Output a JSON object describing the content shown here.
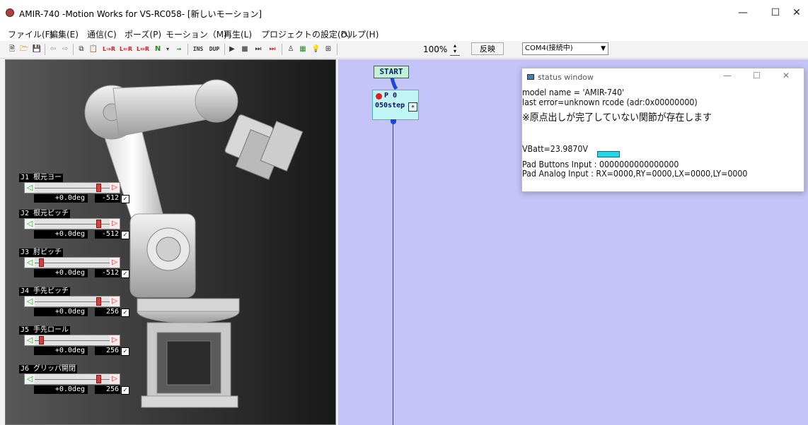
{
  "window": {
    "title": "AMIR-740 -Motion Works for VS-RC058-  [新しいモーション]",
    "minimize": "—",
    "maximize": "☐",
    "close": "✕"
  },
  "menu": [
    "ファイル(F)",
    "編集(E)",
    "通信(C)",
    "ポーズ(P)",
    "モーション（M)",
    "再生(L)",
    "プロジェクトの設定(D)",
    "ヘルプ(H)"
  ],
  "toolbar": {
    "labels": {
      "lr1": "L⇒R",
      "lr2": "L⇐R",
      "lr3": "L⇔R",
      "ins": "INS",
      "dup": "DUP"
    },
    "zoom": "100%",
    "apply": "反映",
    "port": "COM4(接続中)"
  },
  "joints": [
    {
      "label": "J1 根元ヨー",
      "deg": "+0.0deg",
      "limit": "-512",
      "level": 0.86
    },
    {
      "label": "J2 根元ピッチ",
      "deg": "+0.0deg",
      "limit": "-512",
      "level": 0.86
    },
    {
      "label": "J3 肘ピッチ",
      "deg": "+0.0deg",
      "limit": "-512",
      "level": 0.06
    },
    {
      "label": "J4 手先ピッチ",
      "deg": "+0.0deg",
      "limit": "256",
      "level": 0.86
    },
    {
      "label": "J5 手先ロール",
      "deg": "+0.0deg",
      "limit": "256",
      "level": 0.06
    },
    {
      "label": "J6 グリッパ開閉",
      "deg": "+0.0deg",
      "limit": "256",
      "level": 0.86
    }
  ],
  "flow": {
    "start": "START",
    "pose_name": "P 0",
    "pose_steps": "050step"
  },
  "status_window": {
    "title": "status window",
    "model": "model name = 'AMIR-740'",
    "error": "last error=unknown rcode (adr:0x00000000)",
    "note": "※原点出しが完了していない関節が存在します",
    "vbatt": "VBatt=23.9870V",
    "pad_buttons": "Pad Buttons Input : 0000000000000000",
    "pad_analog": "Pad Analog Input : RX=0000,RY=0000,LX=0000,LY=0000"
  }
}
